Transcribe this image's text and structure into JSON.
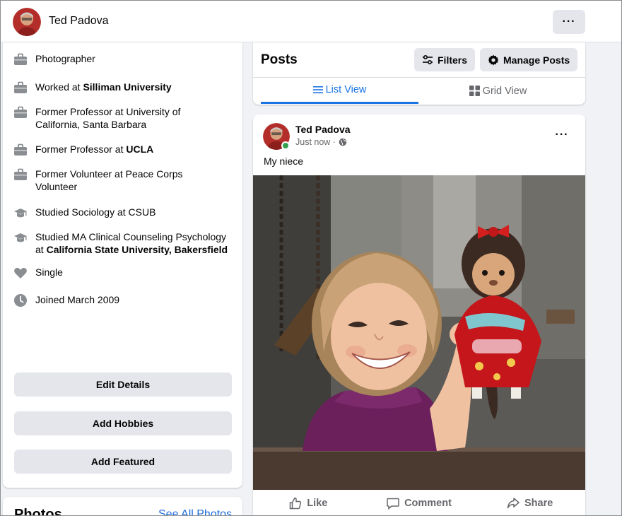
{
  "profile": {
    "name": "Ted Padova",
    "more_label": "···"
  },
  "intro": {
    "items": [
      {
        "icon": "briefcase-icon",
        "prefix": "Photographer",
        "bold": ""
      },
      {
        "icon": "briefcase-icon",
        "prefix": "Worked at ",
        "bold": "Silliman University"
      },
      {
        "icon": "briefcase-icon",
        "prefix": "Former Professor at University of California, Santa Barbara",
        "bold": ""
      },
      {
        "icon": "briefcase-icon",
        "prefix": "Former Professor at ",
        "bold": "UCLA"
      },
      {
        "icon": "briefcase-icon",
        "prefix": "Former Volunteer at Peace Corps Volunteer",
        "bold": ""
      },
      {
        "icon": "graduation-cap-icon",
        "prefix": "Studied Sociology at CSUB",
        "bold": ""
      },
      {
        "icon": "graduation-cap-icon",
        "prefix": "Studied MA Clinical Counseling Psychology at ",
        "bold": "California State University, Bakersfield"
      },
      {
        "icon": "heart-icon",
        "prefix": "Single",
        "bold": ""
      },
      {
        "icon": "clock-icon",
        "prefix": "Joined March 2009",
        "bold": ""
      }
    ],
    "buttons": {
      "edit_details": "Edit Details",
      "add_hobbies": "Add Hobbies",
      "add_featured": "Add Featured"
    }
  },
  "photos": {
    "title": "Photos",
    "see_all": "See All Photos"
  },
  "posts": {
    "title": "Posts",
    "filters_label": "Filters",
    "manage_label": "Manage Posts",
    "tabs": {
      "list_view": "List View",
      "grid_view": "Grid View"
    }
  },
  "post": {
    "author": "Ted Padova",
    "time": "Just now ·",
    "caption": "My niece",
    "more_label": "···",
    "actions": {
      "like": "Like",
      "comment": "Comment",
      "share": "Share"
    }
  },
  "colors": {
    "accent": "#1b74e4",
    "button_gray": "#e4e6eb",
    "background": "#f0f2f5",
    "online": "#31a24c"
  }
}
